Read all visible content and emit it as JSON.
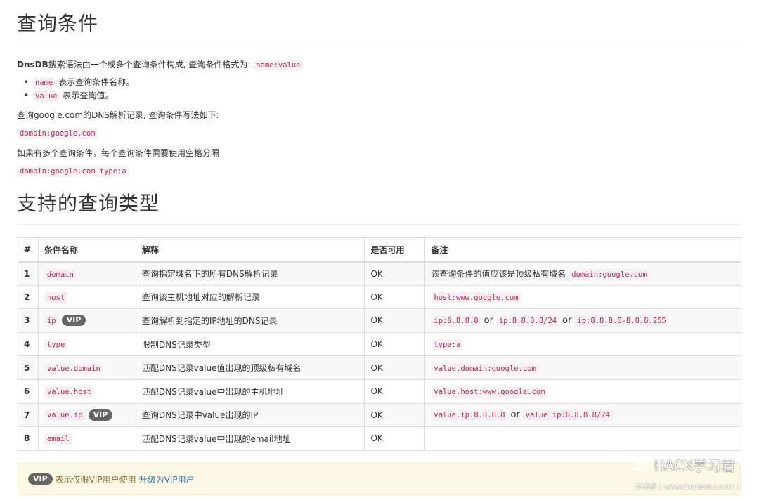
{
  "section1": {
    "title": "查询条件",
    "intro_bold": "DnsDB",
    "intro_text": "搜索语法由一个或多个查询条件构成, 查询条件格式为: ",
    "intro_code": "name:value",
    "bullets": [
      {
        "code": "name",
        "text": " 表示查询条件名称。"
      },
      {
        "code": "value",
        "text": " 表示查询值。"
      }
    ],
    "example1_text": "查询google.com的DNS解析记录, 查询条件写法如下:",
    "example1_code": "domain:google.com",
    "example2_text": "如果有多个查询条件，每个查询条件需要使用空格分隔",
    "example2_code": "domain:google.com type:a"
  },
  "section2": {
    "title": "支持的查询类型",
    "headers": [
      "#",
      "条件名称",
      "解释",
      "是否可用",
      "备注"
    ],
    "rows": [
      {
        "n": "1",
        "name": "domain",
        "vip": false,
        "desc": "查询指定域名下的所有DNS解析记录",
        "ok": "OK",
        "note_text": "该查询条件的值应该是顶级私有域名 ",
        "note_codes": [
          "domain:google.com"
        ],
        "note_sep": ""
      },
      {
        "n": "2",
        "name": "host",
        "vip": false,
        "desc": "查询该主机地址对应的解析记录",
        "ok": "OK",
        "note_text": "",
        "note_codes": [
          "host:www.google.com"
        ],
        "note_sep": ""
      },
      {
        "n": "3",
        "name": "ip",
        "vip": true,
        "desc": "查询解析到指定的IP地址的DNS记录",
        "ok": "OK",
        "note_text": "",
        "note_codes": [
          "ip:8.8.8.8",
          "ip:8.8.8.8/24",
          "ip:8.8.8.0-8.8.8.255"
        ],
        "note_sep": "or"
      },
      {
        "n": "4",
        "name": "type",
        "vip": false,
        "desc": "限制DNS记录类型",
        "ok": "OK",
        "note_text": "",
        "note_codes": [
          "type:a"
        ],
        "note_sep": ""
      },
      {
        "n": "5",
        "name": "value.domain",
        "vip": false,
        "desc": "匹配DNS记录value值出现的顶级私有域名",
        "ok": "OK",
        "note_text": "",
        "note_codes": [
          "value.domain:google.com"
        ],
        "note_sep": ""
      },
      {
        "n": "6",
        "name": "value.host",
        "vip": false,
        "desc": "匹配DNS记录value中出现的主机地址",
        "ok": "OK",
        "note_text": "",
        "note_codes": [
          "value.host:www.google.com"
        ],
        "note_sep": ""
      },
      {
        "n": "7",
        "name": "value.ip",
        "vip": true,
        "desc": "查询DNS记录中value出现的IP",
        "ok": "OK",
        "note_text": "",
        "note_codes": [
          "value.ip:8.8.8.8",
          "value.ip:8.8.8.8/24"
        ],
        "note_sep": "or"
      },
      {
        "n": "8",
        "name": "email",
        "vip": false,
        "desc": "匹配DNS记录value中出现的email地址",
        "ok": "OK",
        "note_text": "",
        "note_codes": [],
        "note_sep": ""
      }
    ],
    "vip_badge": "VIP"
  },
  "alert": {
    "badge": "VIP",
    "text": " 表示仅限VIP用户使用 ",
    "link": "升级为VIP用户",
    "color_bg": "#fcf8e3"
  },
  "watermark": {
    "brand": "HACK学习君",
    "sub": "安全客 ( www.anquanke.com )"
  }
}
